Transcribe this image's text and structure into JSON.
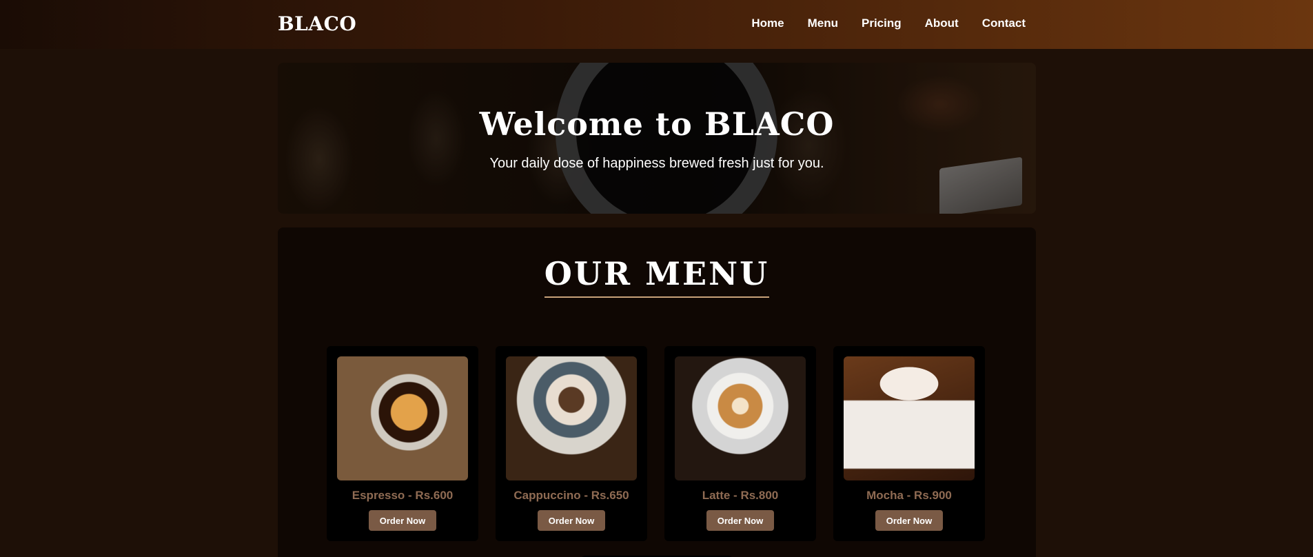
{
  "header": {
    "brand": "BLACO",
    "nav": [
      "Home",
      "Menu",
      "Pricing",
      "About",
      "Contact"
    ]
  },
  "hero": {
    "title": "Welcome to BLACO",
    "subtitle": "Your daily dose of happiness brewed fresh just for you."
  },
  "menu": {
    "title": "OUR MENU",
    "items": [
      {
        "name": "Espresso - Rs.600",
        "button": "Order Now"
      },
      {
        "name": "Cappuccino - Rs.650",
        "button": "Order Now"
      },
      {
        "name": "Latte - Rs.800",
        "button": "Order Now"
      },
      {
        "name": "Mocha - Rs.900",
        "button": "Order Now"
      }
    ]
  },
  "colors": {
    "background": "#1e1007",
    "accent_brown": "#7a5a45",
    "price_text": "#8f6b53",
    "underline": "#c8a27a"
  }
}
